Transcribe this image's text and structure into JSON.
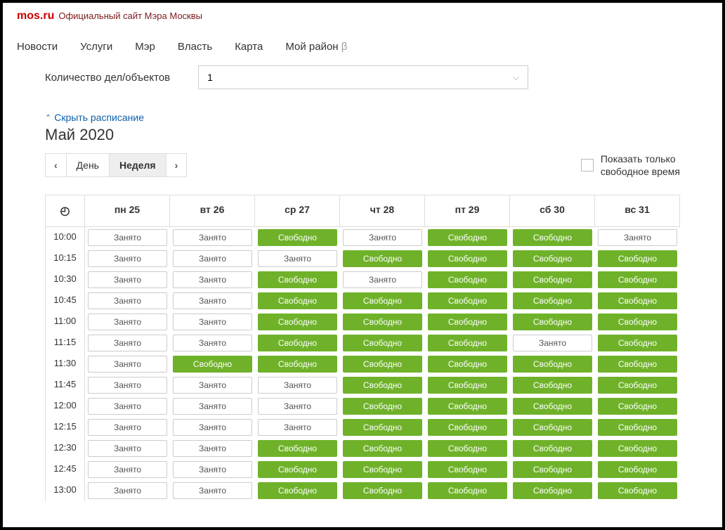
{
  "header": {
    "logo": "mos.ru",
    "tagline": "Официальный сайт Мэра Москвы"
  },
  "nav": [
    {
      "label": "Новости"
    },
    {
      "label": "Услуги"
    },
    {
      "label": "Мэр"
    },
    {
      "label": "Власть"
    },
    {
      "label": "Карта"
    },
    {
      "label": "Мой район",
      "beta": "β"
    }
  ],
  "qty": {
    "label": "Количество дел/объектов",
    "value": "1"
  },
  "hide": "Скрыть расписание",
  "month": "Май 2020",
  "view": {
    "prev": "‹",
    "day": "День",
    "week": "Неделя",
    "next": "›"
  },
  "freeOnly": "Показать только\nсвободное время",
  "status": {
    "busy": "Занято",
    "free": "Свободно"
  },
  "days": [
    "пн 25",
    "вт 26",
    "ср 27",
    "чт 28",
    "пт 29",
    "сб 30",
    "вс 31"
  ],
  "times": [
    "10:00",
    "10:15",
    "10:30",
    "10:45",
    "11:00",
    "11:15",
    "11:30",
    "11:45",
    "12:00",
    "12:15",
    "12:30",
    "12:45",
    "13:00"
  ],
  "slots": [
    [
      "b",
      "b",
      "f",
      "b",
      "f",
      "f",
      "b"
    ],
    [
      "b",
      "b",
      "b",
      "f",
      "f",
      "f",
      "f"
    ],
    [
      "b",
      "b",
      "f",
      "b",
      "f",
      "f",
      "f"
    ],
    [
      "b",
      "b",
      "f",
      "f",
      "f",
      "f",
      "f"
    ],
    [
      "b",
      "b",
      "f",
      "f",
      "f",
      "f",
      "f"
    ],
    [
      "b",
      "b",
      "f",
      "f",
      "f",
      "b",
      "f"
    ],
    [
      "b",
      "f",
      "f",
      "f",
      "f",
      "f",
      "f"
    ],
    [
      "b",
      "b",
      "b",
      "f",
      "f",
      "f",
      "f"
    ],
    [
      "b",
      "b",
      "b",
      "f",
      "f",
      "f",
      "f"
    ],
    [
      "b",
      "b",
      "b",
      "f",
      "f",
      "f",
      "f"
    ],
    [
      "b",
      "b",
      "f",
      "f",
      "f",
      "f",
      "f"
    ],
    [
      "b",
      "b",
      "f",
      "f",
      "f",
      "f",
      "f"
    ],
    [
      "b",
      "b",
      "f",
      "f",
      "f",
      "f",
      "f"
    ]
  ]
}
